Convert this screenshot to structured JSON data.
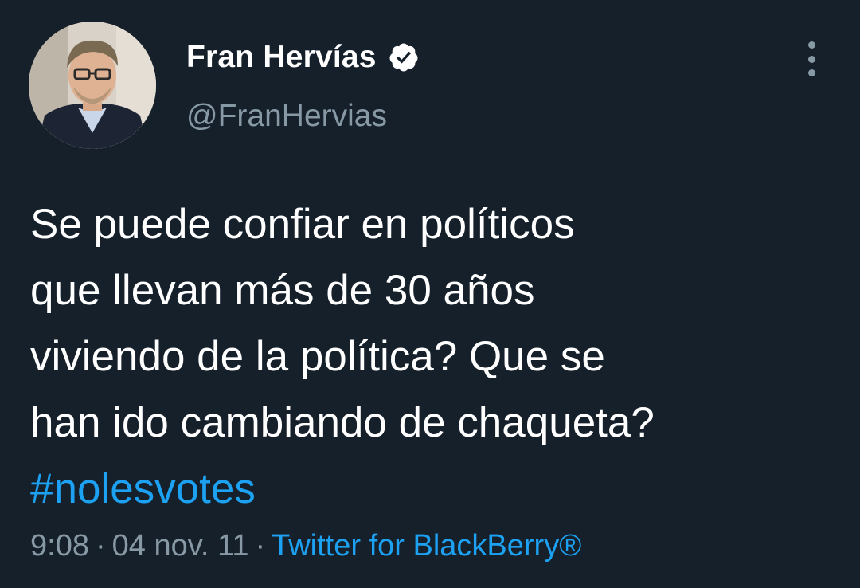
{
  "tweet": {
    "display_name": "Fran Hervías",
    "handle": "@FranHervias",
    "verified": true,
    "avatar_icon": "profile-photo",
    "more_icon": "more-vertical-icon",
    "text_lines": [
      "Se puede confiar en políticos",
      "que llevan más de 30 años",
      "viviendo de la política? Que se",
      "han ido cambiando de chaqueta?"
    ],
    "hashtag": "#nolesvotes",
    "time": "9:08",
    "separator": "·",
    "date": "04 nov. 11",
    "source": "Twitter for BlackBerry®"
  },
  "colors": {
    "background": "#15202b",
    "text": "#ffffff",
    "secondary": "#8899a6",
    "accent": "#1da1f2"
  }
}
